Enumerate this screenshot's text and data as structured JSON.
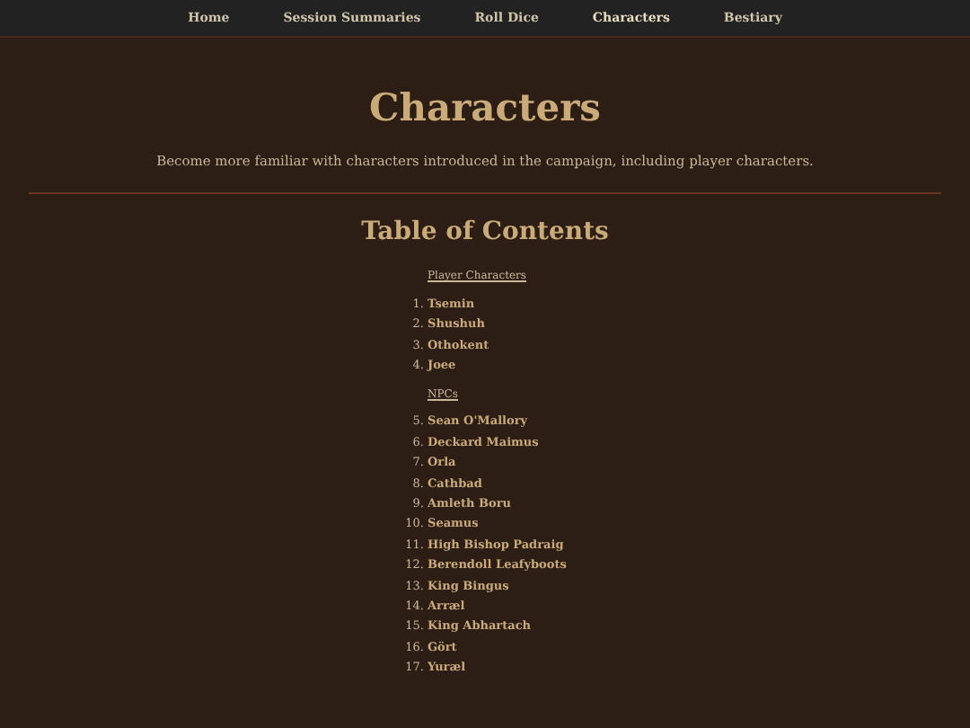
{
  "nav": [
    {
      "label": "Home",
      "selected": false
    },
    {
      "label": "Session Summaries",
      "selected": false
    },
    {
      "label": "Roll Dice",
      "selected": false
    },
    {
      "label": "Characters",
      "selected": true
    },
    {
      "label": "Bestiary",
      "selected": false
    }
  ],
  "title": "Characters",
  "subtitle": "Become more familiar with characters introduced in the campaign, including player characters.",
  "toc": {
    "heading": "Table of Contents",
    "sections": [
      {
        "heading": "Player Characters",
        "items": [
          {
            "number": "1.",
            "name": "Tsemin"
          },
          {
            "number": "2.",
            "name": "Shushuh"
          },
          {
            "number": "3.",
            "name": "Othokent"
          },
          {
            "number": "4.",
            "name": "Joee"
          }
        ]
      },
      {
        "heading": "NPCs",
        "items": [
          {
            "number": "5.",
            "name": "Sean O'Mallory"
          },
          {
            "number": "6.",
            "name": "Deckard Maimus"
          },
          {
            "number": "7.",
            "name": "Orla"
          },
          {
            "number": "8.",
            "name": "Cathbad"
          },
          {
            "number": "9.",
            "name": "Amleth Boru"
          },
          {
            "number": "10.",
            "name": "Seamus"
          },
          {
            "number": "11.",
            "name": "High Bishop Padraig"
          },
          {
            "number": "12.",
            "name": "Berendoll Leafyboots"
          },
          {
            "number": "13.",
            "name": "King Bingus"
          },
          {
            "number": "14.",
            "name": "Arræl"
          },
          {
            "number": "15.",
            "name": "King Abhartach"
          },
          {
            "number": "16.",
            "name": "Gört"
          },
          {
            "number": "17.",
            "name": "Yuræl"
          }
        ]
      }
    ]
  }
}
